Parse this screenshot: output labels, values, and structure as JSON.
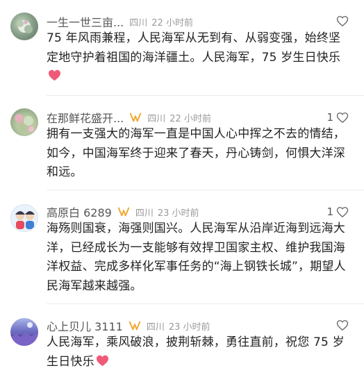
{
  "comments": [
    {
      "username": "一生一世三亩...",
      "vip": false,
      "location": "四川",
      "time": "22 小时前",
      "likes": "",
      "content": "75 年风雨兼程，人民海军从无到有、从弱变强，始终坚定地守护着祖国的海洋疆土。人民海军，75 岁生日快乐",
      "emoji": "heart-emoji"
    },
    {
      "username": "在那鲜花盛开...",
      "vip": true,
      "location": "四川",
      "time": "22 小时前",
      "likes": "1",
      "content": "拥有一支强大的海军一直是中国人心中挥之不去的情结，如今，中国海军终于迎来了春天，丹心铸剑，何惧大洋深和远。",
      "emoji": ""
    },
    {
      "username": "高原白 6289",
      "vip": true,
      "location": "四川",
      "time": "23 小时前",
      "likes": "1",
      "content": "海殇则国衰，海强则国兴。人民海军从沿岸近海到远海大洋，已经成长为一支能够有效捍卫国家主权、维护我国海洋权益、完成多样化军事任务的“海上钢铁长城”，期望人民海军越来越强。",
      "emoji": ""
    },
    {
      "username": "心上贝儿 3111",
      "vip": true,
      "location": "四川",
      "time": "23 小时前",
      "likes": "",
      "content": "人民海军，乘风破浪，披荆斩棘，勇往直前，祝您 75 岁生日快乐",
      "emoji": "heart-emoji"
    }
  ],
  "colors": {
    "accent_vip": "#f0a830",
    "heart": "#f05a78",
    "text": "#222222",
    "meta": "#9a9a9a"
  }
}
